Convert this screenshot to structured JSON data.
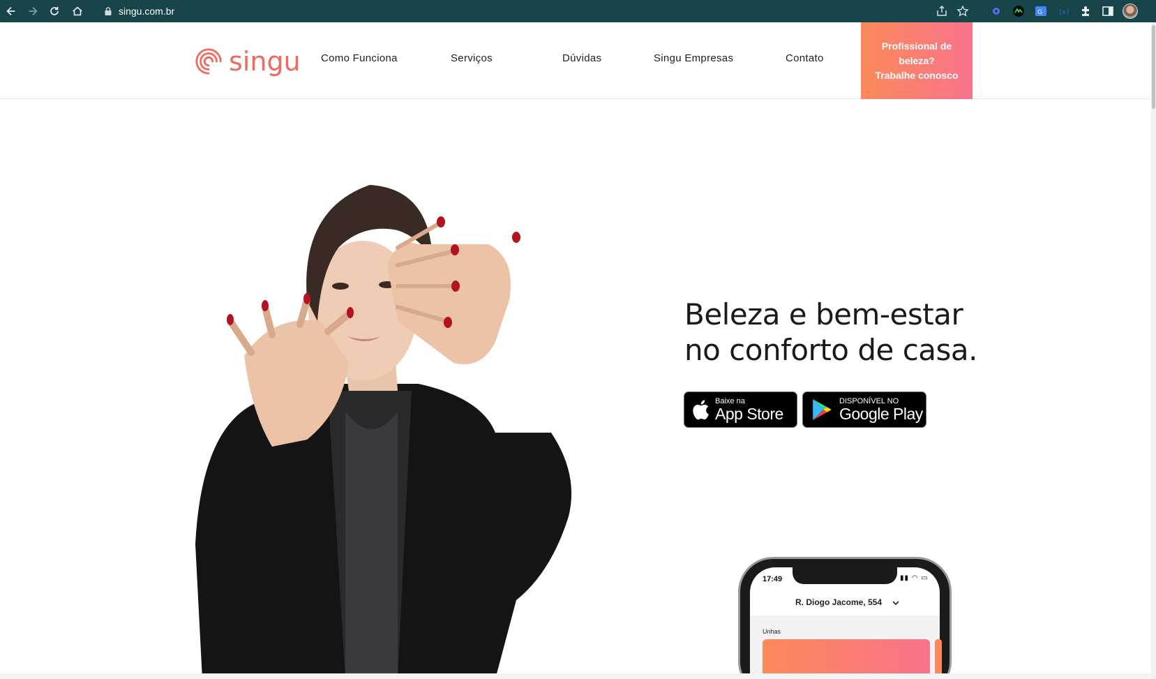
{
  "browser": {
    "url": "singu.com.br"
  },
  "header": {
    "logo_text": "singu",
    "menu": [
      {
        "label": "Como Funciona"
      },
      {
        "label": "Serviços"
      },
      {
        "label": "Dúvidas"
      },
      {
        "label": "Singu Empresas"
      },
      {
        "label": "Contato"
      }
    ],
    "cta_lines": [
      "Profissional de",
      "beleza?",
      "Trabalhe conosco"
    ],
    "brand_color": "#ef6a5f",
    "cta_gradient": [
      "#fb8a5a",
      "#f8738b"
    ]
  },
  "hero": {
    "headline_line1": "Beleza e bem-estar",
    "headline_line2": "no conforto de casa.",
    "app_store": {
      "small": "Baixe na",
      "big": "App Store"
    },
    "google_play": {
      "small": "DISPONÍVEL NO",
      "big": "Google Play"
    }
  },
  "phone": {
    "time": "17:49",
    "address": "R. Diogo Jacome, 554",
    "section": "Unhas"
  }
}
